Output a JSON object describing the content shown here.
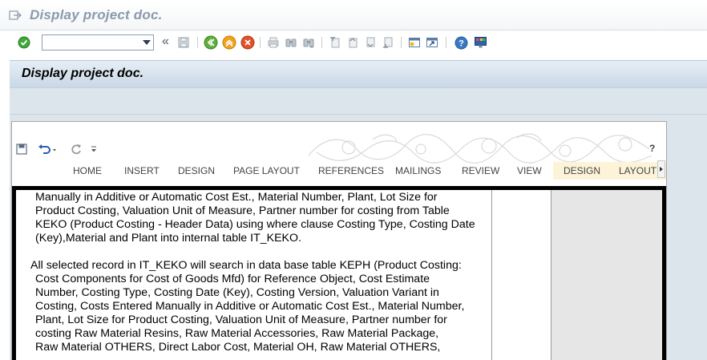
{
  "window": {
    "title": "Display project doc."
  },
  "toolbar": {
    "command_field_value": "",
    "enter_icon": "green-check-icon",
    "save_icon": "save-icon",
    "back_icon": "back-icon",
    "exit_icon": "exit-icon",
    "cancel_icon": "cancel-icon",
    "print_icon": "print-icon",
    "find_icon": "find-icon",
    "find_next_icon": "find-next-icon",
    "first_page_icon": "first-page-icon",
    "prev_page_icon": "previous-page-icon",
    "next_page_icon": "next-page-icon",
    "last_page_icon": "last-page-icon",
    "new_session_icon": "new-session-icon",
    "shortcut_icon": "create-shortcut-icon",
    "help_icon": "help-icon",
    "layout_icon": "customize-layout-icon",
    "double_arrow": "«"
  },
  "app": {
    "header_title": "Display project doc."
  },
  "word": {
    "help_label": "?",
    "tabs": [
      "HOME",
      "INSERT",
      "DESIGN",
      "PAGE LAYOUT",
      "REFERENCES",
      "MAILINGS",
      "REVIEW",
      "VIEW",
      "DESIGN",
      "LAYOUT"
    ],
    "colors": {
      "contextual_tab_bg": "#fdf3d8",
      "accent_blue": "#2a5ea8"
    }
  },
  "document": {
    "para1_lines": [
      "Manually in Additive or Automatic Cost Est., Material Number, Plant, Lot Size for",
      "Product Costing, Valuation Unit of Measure, Partner number for costing from Table",
      "KEKO (Product Costing - Header Data) using where clause Costing Type, Costing Date",
      "(Key),Material and Plant into internal table IT_KEKO."
    ],
    "para2_first": "All selected record in IT_KEKO will search in data base table KEPH (Product Costing:",
    "para2_lines": [
      "Cost Components for Cost of Goods Mfd) for Reference Object, Cost Estimate",
      "Number, Costing Type, Costing Date (Key), Costing Version, Valuation Variant in",
      "Costing, Costs Entered Manually in Additive or Automatic Cost Est., Material Number,",
      "Plant, Lot Size for Product Costing, Valuation Unit of Measure, Partner number for",
      "costing Raw Material Resins, Raw Material Accessories, Raw Material Package,",
      "Raw Material OTHERS, Direct Labor Cost, Material OH, Raw Material OTHERS,"
    ]
  }
}
